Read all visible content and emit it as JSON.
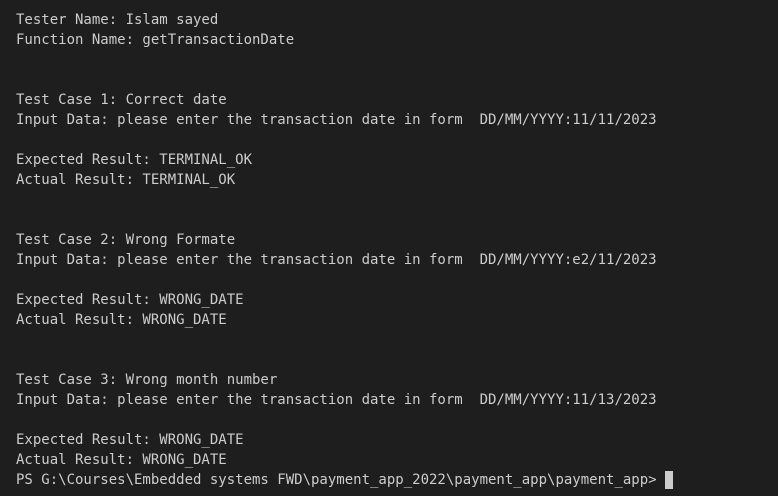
{
  "terminal": {
    "lines": [
      "Tester Name: Islam sayed",
      "Function Name: getTransactionDate",
      "",
      "",
      "Test Case 1: Correct date",
      "Input Data: please enter the transaction date in form  DD/MM/YYYY:11/11/2023",
      "",
      "Expected Result: TERMINAL_OK",
      "Actual Result: TERMINAL_OK",
      "",
      "",
      "Test Case 2: Wrong Formate",
      "Input Data: please enter the transaction date in form  DD/MM/YYYY:e2/11/2023",
      "",
      "Expected Result: WRONG_DATE",
      "Actual Result: WRONG_DATE",
      "",
      "",
      "Test Case 3: Wrong month number",
      "Input Data: please enter the transaction date in form  DD/MM/YYYY:11/13/2023",
      "",
      "Expected Result: WRONG_DATE",
      "Actual Result: WRONG_DATE"
    ],
    "prompt": "PS G:\\Courses\\Embedded systems FWD\\payment_app_2022\\payment_app\\payment_app>"
  },
  "colors": {
    "background": "#1e1e1e",
    "text": "#cccccc",
    "cursor": "#cccccc"
  }
}
